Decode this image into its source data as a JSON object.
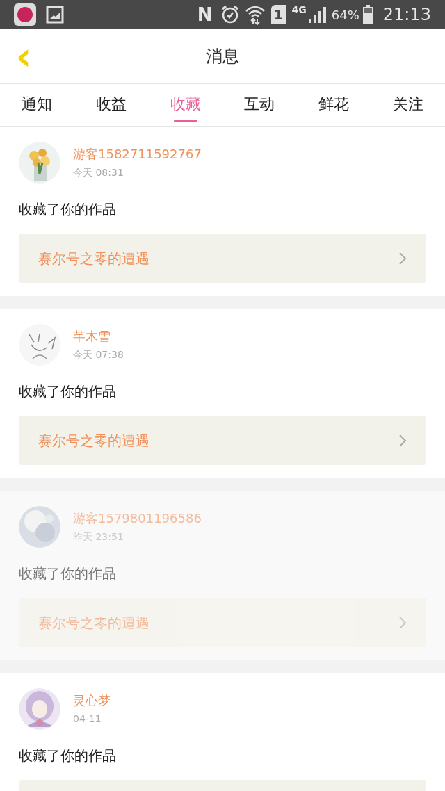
{
  "status_bar": {
    "nfc": "N",
    "sim": "1",
    "network": "4G",
    "battery": "64%",
    "time": "21:13"
  },
  "header": {
    "back": "‹",
    "title": "消息"
  },
  "tabs": [
    {
      "label": "通知",
      "selected": false
    },
    {
      "label": "收益",
      "selected": false
    },
    {
      "label": "收藏",
      "selected": true
    },
    {
      "label": "互动",
      "selected": false
    },
    {
      "label": "鲜花",
      "selected": false
    },
    {
      "label": "关注",
      "selected": false
    }
  ],
  "messages": [
    {
      "name": "游客1582711592767",
      "time": "今天 08:31",
      "action": "收藏了你的作品",
      "work_title": "赛尔号之零的遭遇",
      "faded": false
    },
    {
      "name": "芊木雪",
      "time": "今天 07:38",
      "action": "收藏了你的作品",
      "work_title": "赛尔号之零的遭遇",
      "faded": false
    },
    {
      "name": "游客1579801196586",
      "time": "昨天 23:51",
      "action": "收藏了你的作品",
      "work_title": "赛尔号之零的遭遇",
      "faded": true
    },
    {
      "name": "灵心梦",
      "time": "04-11",
      "action": "收藏了你的作品",
      "faded": false
    }
  ]
}
